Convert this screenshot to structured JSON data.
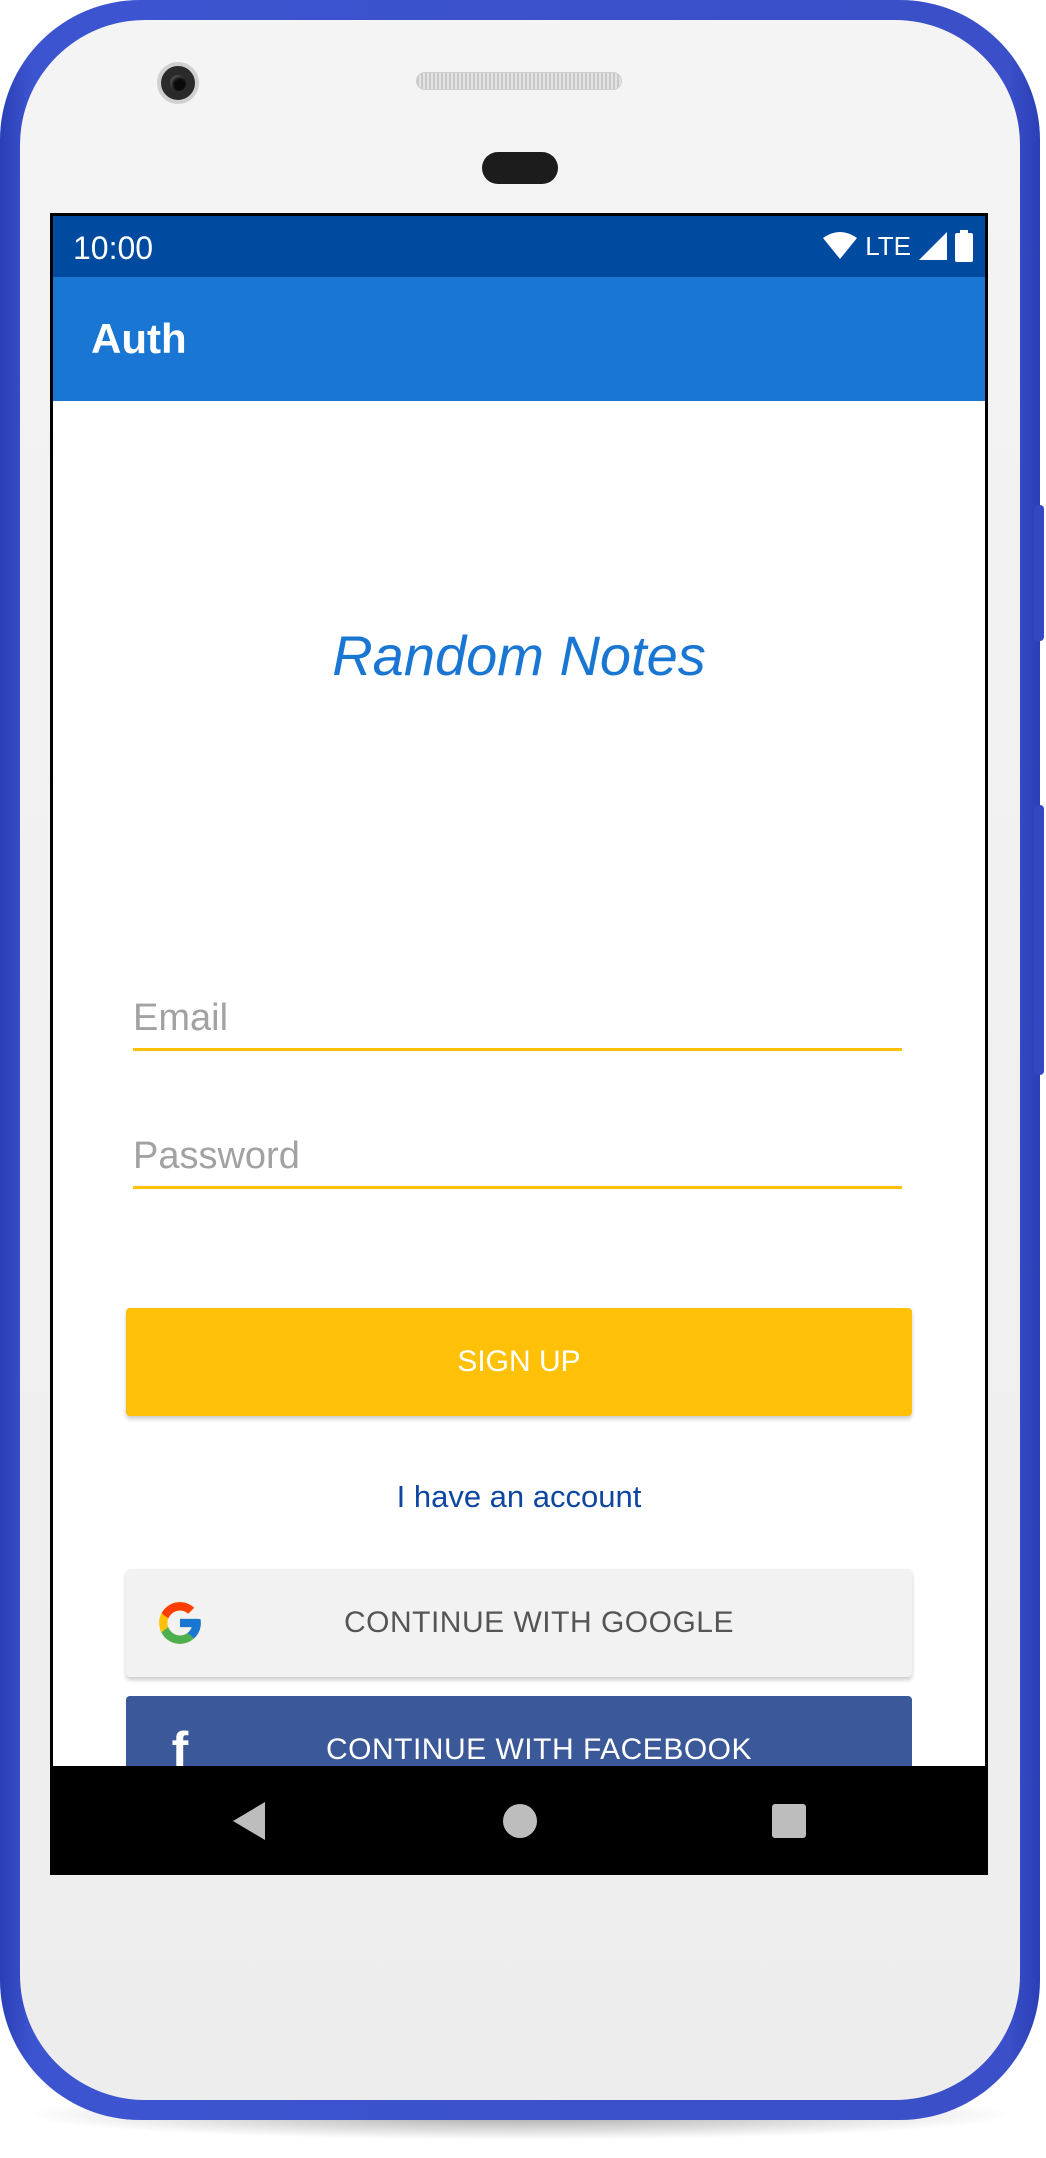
{
  "statusbar": {
    "time": "10:00",
    "network_label": "LTE"
  },
  "appbar": {
    "title": "Auth"
  },
  "brand": {
    "title": "Random Notes"
  },
  "form": {
    "email_placeholder": "Email",
    "password_placeholder": "Password",
    "signup_label": "SIGN UP",
    "have_account_label": "I have an account"
  },
  "social": {
    "google_label": "CONTINUE WITH GOOGLE",
    "facebook_label": "CONTINUE WITH FACEBOOK",
    "facebook_glyph": "f"
  },
  "navbar": {
    "back": "back-icon",
    "home": "home-icon",
    "recents": "recents-icon"
  },
  "colors": {
    "statusbar": "#004ba0",
    "appbar": "#1976d2",
    "accent": "#ffc107",
    "link": "#0d47a1",
    "google_button": "#f2f2f2",
    "facebook_button": "#3b5998",
    "phone_frame": "#3a4fc8"
  }
}
